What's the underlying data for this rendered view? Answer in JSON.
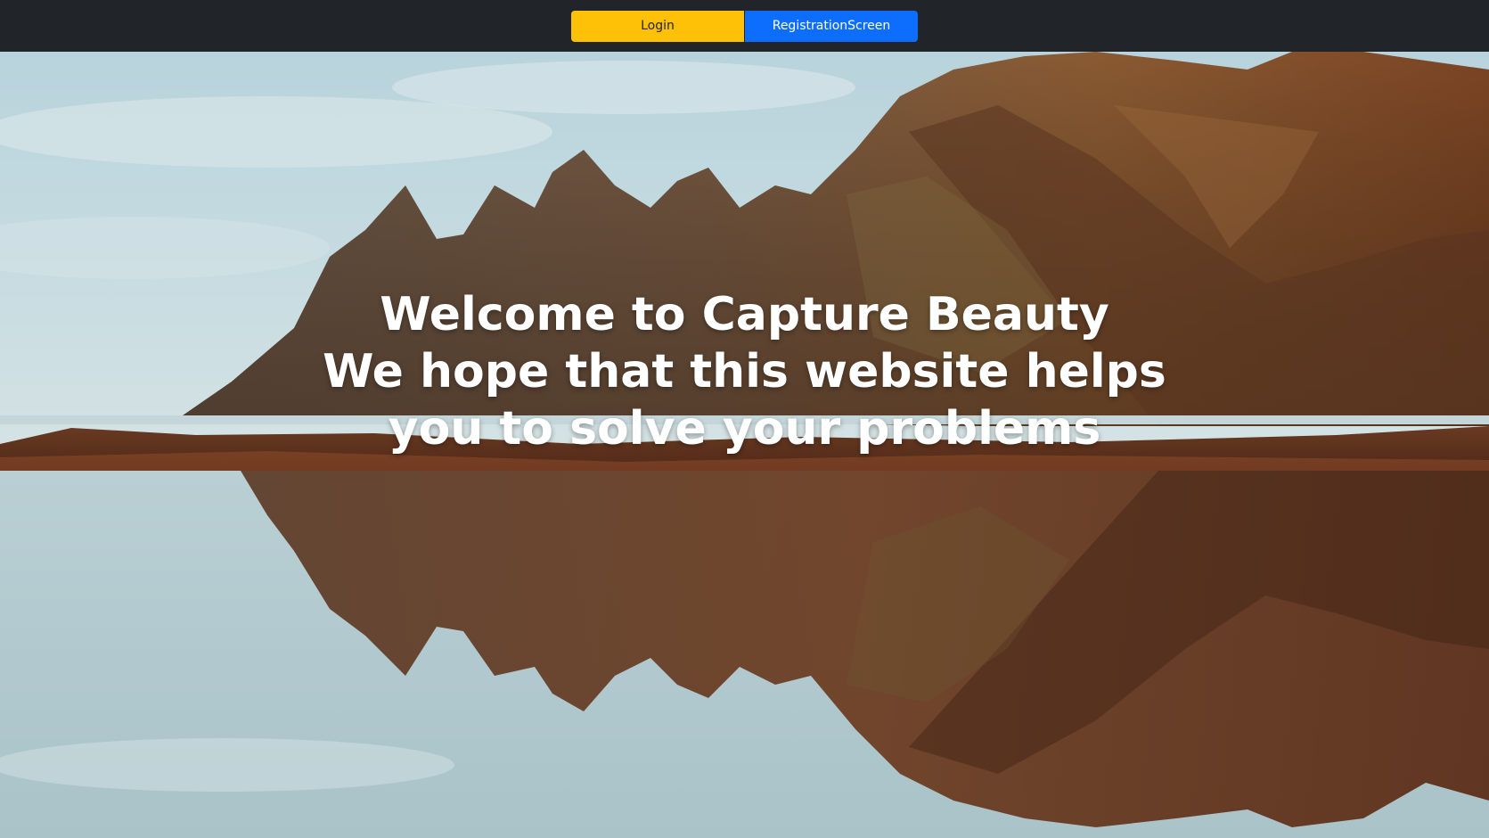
{
  "navbar": {
    "login_label": "Login",
    "register_label": "RegistrationScreen",
    "colors": {
      "background": "#212529",
      "login": "#ffc107",
      "register": "#0d6efd"
    }
  },
  "hero": {
    "line1": "Welcome to Capture Beauty",
    "line2": "We hope that this website helps",
    "line3": "you to solve your problems",
    "background_image": "mountain-lake-reflection"
  }
}
